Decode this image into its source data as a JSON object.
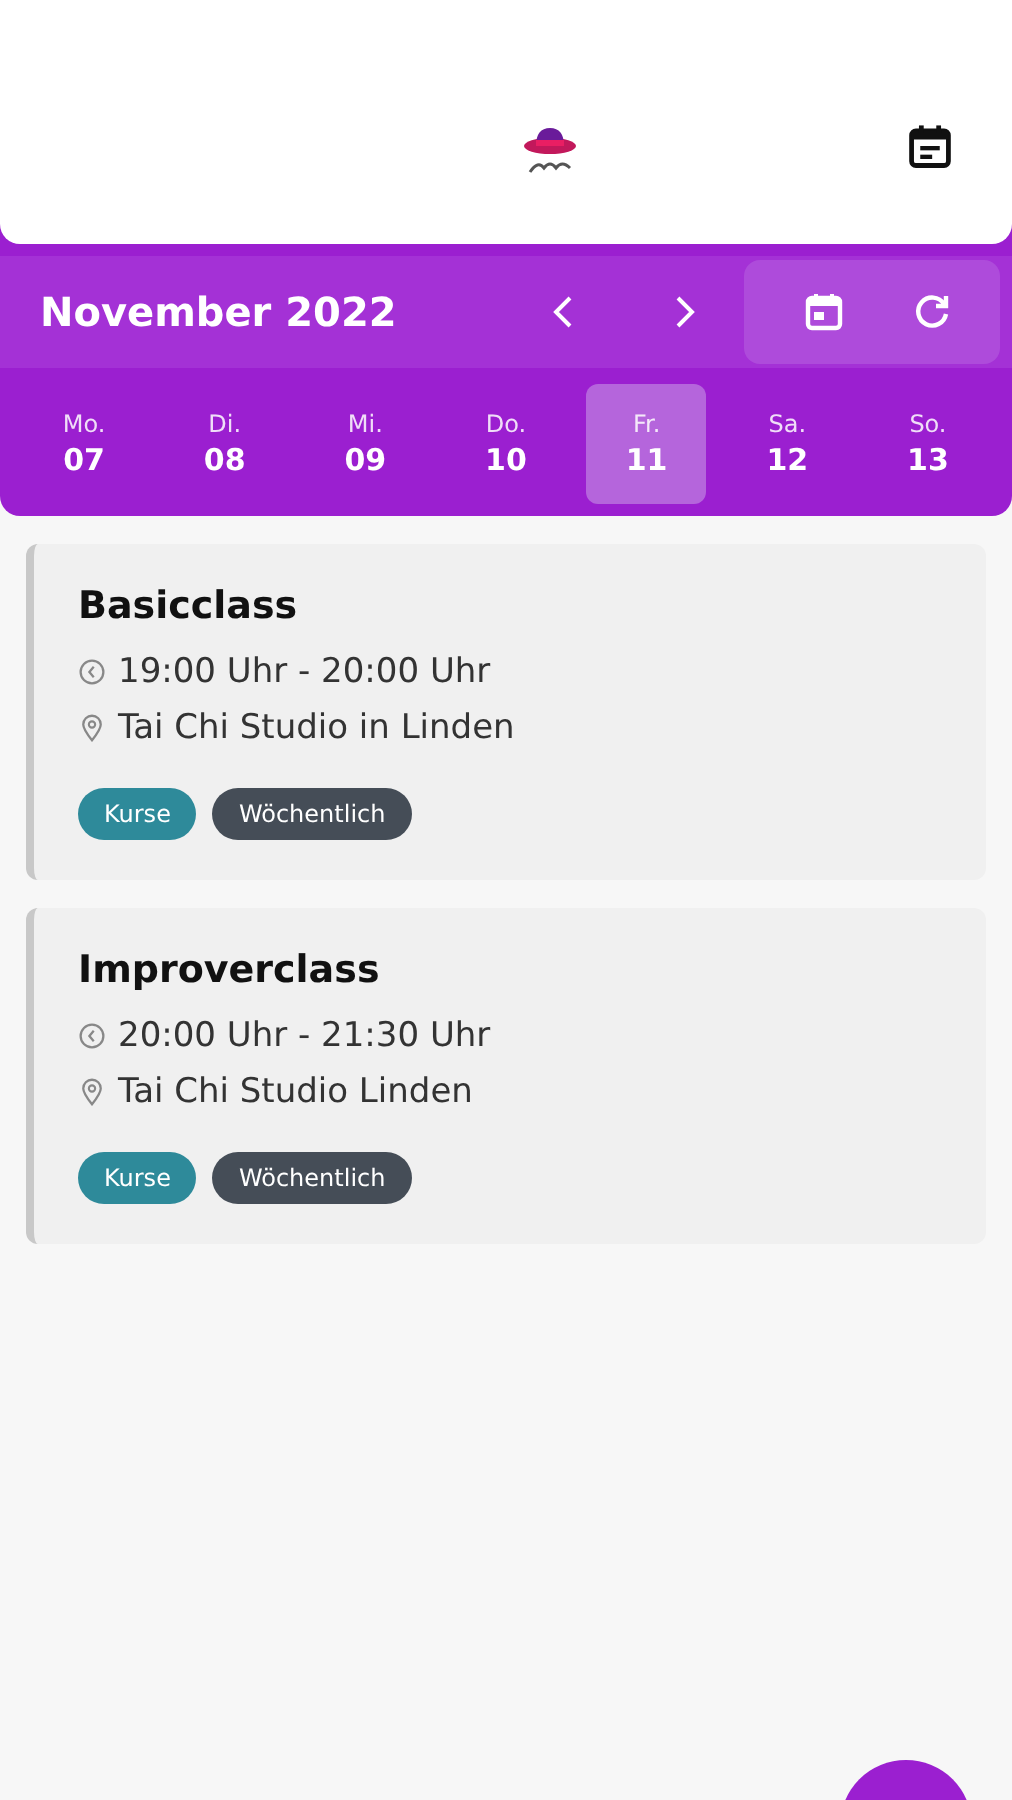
{
  "header": {
    "month": "November 2022"
  },
  "days": [
    {
      "weekday": "Mo.",
      "date": "07",
      "selected": false
    },
    {
      "weekday": "Di.",
      "date": "08",
      "selected": false
    },
    {
      "weekday": "Mi.",
      "date": "09",
      "selected": false
    },
    {
      "weekday": "Do.",
      "date": "10",
      "selected": false
    },
    {
      "weekday": "Fr.",
      "date": "11",
      "selected": true
    },
    {
      "weekday": "Sa.",
      "date": "12",
      "selected": false
    },
    {
      "weekday": "So.",
      "date": "13",
      "selected": false
    }
  ],
  "events": [
    {
      "title": "Basicclass",
      "time": "19:00  Uhr - 20:00  Uhr",
      "location": "Tai Chi Studio in Linden",
      "tags": [
        {
          "label": "Kurse",
          "color": "#2e8a9a"
        },
        {
          "label": "Wöchentlich",
          "color": "#454d57"
        }
      ]
    },
    {
      "title": "Improverclass",
      "time": "20:00  Uhr - 21:30  Uhr",
      "location": "Tai Chi Studio Linden",
      "tags": [
        {
          "label": "Kurse",
          "color": "#2e8a9a"
        },
        {
          "label": "Wöchentlich",
          "color": "#454d57"
        }
      ]
    }
  ]
}
